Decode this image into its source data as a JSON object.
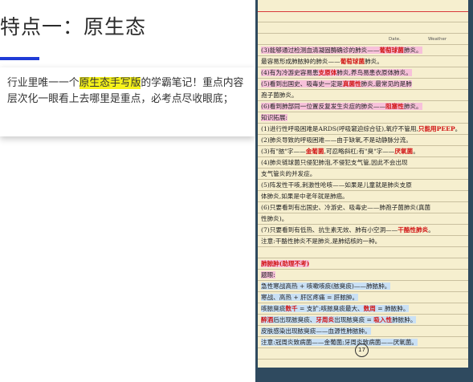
{
  "left": {
    "title": "特点一：原生态",
    "para_before": "行业里唯一一个",
    "para_highlight": "原生态手写版",
    "para_after": "的学霸笔记！重点内容层次化一眼看上去哪里是重点，必考点尽收眼底；"
  },
  "notebook": {
    "date_label": "Date.",
    "weather_label": "Weather",
    "page_number": "17",
    "lines": [
      {
        "parts": [
          {
            "t": "(3)能够通过检测血清凝固酶确诊的肺炎——"
          },
          {
            "t": "葡萄球菌",
            "red": true
          },
          {
            "t": "肺炎。"
          }
        ],
        "hl": "pk"
      },
      {
        "parts": [
          {
            "t": "最容易形成肺脓肿的肺炎——"
          },
          {
            "t": "葡萄球菌",
            "red": true
          },
          {
            "t": "肺炎。"
          }
        ],
        "hl": ""
      },
      {
        "parts": [
          {
            "t": "(4)有为冷游史容易患"
          },
          {
            "t": "支原体",
            "red": true
          },
          {
            "t": "肺炎,养鸟易患衣原体肺炎。"
          }
        ],
        "hl": "pk"
      },
      {
        "parts": [
          {
            "t": "(5)看到出国史、吸毒史一定是"
          },
          {
            "t": "真菌性",
            "red": true
          },
          {
            "t": "肺炎,最常见的是肺"
          }
        ],
        "hl": "pk"
      },
      {
        "parts": [
          {
            "t": "孢子菌肺炎。"
          }
        ],
        "hl": ""
      },
      {
        "parts": [
          {
            "t": "(6)看到肺部同一位置反复发生炎症的肺炎——"
          },
          {
            "t": "阻塞性",
            "red": true
          },
          {
            "t": "肺炎。"
          }
        ],
        "hl": "pk"
      },
      {
        "parts": [
          {
            "t": "知识拓展:"
          }
        ],
        "hl": "pk"
      },
      {
        "parts": [
          {
            "t": "(1)进行性呼吸困难是ARDS(呼吸窘迫综合征),氧疗不管用,"
          },
          {
            "t": "只能用PEEP",
            "red": true
          },
          {
            "t": "。"
          }
        ],
        "hl": ""
      },
      {
        "parts": [
          {
            "t": "(2)肺炎导致的呼吸困难——由于缺氧,不是动静脉分流。"
          }
        ],
        "hl": ""
      },
      {
        "parts": [
          {
            "t": "(3)有\"脓\"字——"
          },
          {
            "t": "金葡菌",
            "red": true
          },
          {
            "t": ",可忍略斜杠;有\"臭\"字——"
          },
          {
            "t": "厌氧菌",
            "red": true
          },
          {
            "t": "。"
          }
        ],
        "hl": ""
      },
      {
        "parts": [
          {
            "t": "(4)肺炎链球菌只侵犯肺泡,不侵犯支气管,因此不会出现"
          }
        ],
        "hl": ""
      },
      {
        "parts": [
          {
            "t": "支气管炎的并发症。"
          }
        ],
        "hl": ""
      },
      {
        "parts": [
          {
            "t": "(5)阵发性干咳,刺激性呛咳——如果是儿童就是肺炎支原"
          }
        ],
        "hl": ""
      },
      {
        "parts": [
          {
            "t": "体肺炎,如果是中老年就是肺癌。"
          }
        ],
        "hl": ""
      },
      {
        "parts": [
          {
            "t": "(6)只要看到有出国史、冷游史、吸毒史——肺孢子菌肺炎(真菌"
          }
        ],
        "hl": ""
      },
      {
        "parts": [
          {
            "t": "性肺炎)。"
          }
        ],
        "hl": ""
      },
      {
        "parts": [
          {
            "t": "(7)只要看到有低热、抗生素无效、肺有小空洞——"
          },
          {
            "t": "干酪性肺炎",
            "red": true
          },
          {
            "t": "。"
          }
        ],
        "hl": ""
      },
      {
        "parts": [
          {
            "t": "注意:干酪性肺炎不是肺炎,是肺结核的一种。"
          }
        ],
        "hl": ""
      },
      {
        "parts": [
          {
            "t": ""
          }
        ],
        "hl": ""
      },
      {
        "parts": [
          {
            "t": "肺脓肿(助理不考)",
            "red": true
          }
        ],
        "hl": "pk"
      },
      {
        "parts": [
          {
            "t": "题眼:"
          }
        ],
        "hl": "pk"
      },
      {
        "parts": [
          {
            "t": "急性寒战高热 + 咳嗽咳痰(脓臭痰)——肺脓肿。"
          }
        ],
        "hl": "bl"
      },
      {
        "parts": [
          {
            "t": "寒战、高热 + 肝区疼痛 = 肝脓肿。"
          }
        ],
        "hl": "bl"
      },
      {
        "parts": [
          {
            "t": "咳脓臭痰"
          },
          {
            "t": "数千",
            "red": true
          },
          {
            "t": " = 支扩;咳脓臭痰最大、"
          },
          {
            "t": "数周",
            "red": true
          },
          {
            "t": " = 肺脓肿。"
          }
        ],
        "hl": "bl"
      },
      {
        "parts": [
          {
            "t": "醉酒",
            "red": true
          },
          {
            "t": "后出现脓臭痰、"
          },
          {
            "t": "牙周炎",
            "red": true
          },
          {
            "t": "出现脓臭痰 = "
          },
          {
            "t": "吸入性",
            "red": true
          },
          {
            "t": "肺脓肿。"
          }
        ],
        "hl": "bl"
      },
      {
        "parts": [
          {
            "t": "皮肤感染出现脓臭痰——血源性肺脓肿。"
          }
        ],
        "hl": "bl"
      },
      {
        "parts": [
          {
            "t": "注意:冠周炎致病菌——金葡菌;牙周炎致病菌——厌氧菌。"
          }
        ],
        "hl": "bl"
      }
    ]
  }
}
